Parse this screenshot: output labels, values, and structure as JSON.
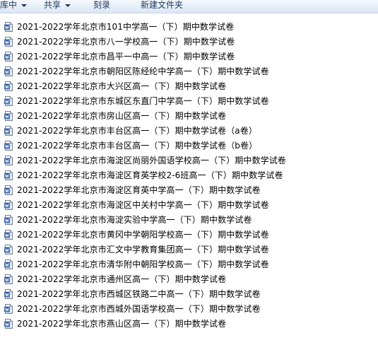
{
  "toolbar": {
    "items": [
      {
        "label": "库中"
      },
      {
        "label": "共享"
      },
      {
        "label": "刻录"
      },
      {
        "label": "新建文件夹"
      }
    ]
  },
  "files": [
    {
      "name": "2021-2022学年北京市101中学高一（下）期中数学试卷",
      "icon": "word-doc-icon"
    },
    {
      "name": "2021-2022学年北京市八一学校高一（下）期中数学试卷",
      "icon": "word-doc-icon"
    },
    {
      "name": "2021-2022学年北京市昌平一中高一（下）期中数学试卷",
      "icon": "word-doc-icon"
    },
    {
      "name": "2021-2022学年北京市朝阳区陈经纶中学高一（下）期中数学试卷",
      "icon": "word-doc-icon"
    },
    {
      "name": "2021-2022学年北京市大兴区高一（下）期中数学试卷",
      "icon": "word-doc-icon"
    },
    {
      "name": "2021-2022学年北京市东城区东直门中学高一（下）期中数学试卷",
      "icon": "word-doc-icon"
    },
    {
      "name": "2021-2022学年北京市房山区高一（下）期中数学试卷",
      "icon": "word-doc-icon"
    },
    {
      "name": "2021-2022学年北京市丰台区高一（下）期中数学试卷（a卷）",
      "icon": "word-doc-icon"
    },
    {
      "name": "2021-2022学年北京市丰台区高一（下）期中数学试卷（b卷）",
      "icon": "word-doc-icon"
    },
    {
      "name": "2021-2022学年北京市海淀区尚丽外国语学校高一（下）期中数学试卷",
      "icon": "word-doc-icon"
    },
    {
      "name": "2021-2022学年北京市海淀区育英学校2-6班高一（下）期中数学试卷",
      "icon": "word-doc-icon"
    },
    {
      "name": "2021-2022学年北京市海淀区育英中学高一（下）期中数学试卷",
      "icon": "word-doc-icon"
    },
    {
      "name": "2021-2022学年北京市海淀区中关村中学高一（下）期中数学试卷",
      "icon": "word-doc-icon"
    },
    {
      "name": "2021-2022学年北京市海淀实验中学高一（下）期中数学试卷",
      "icon": "word-doc-icon"
    },
    {
      "name": "2021-2022学年北京市黄冈中学朝阳学校高一（下）期中数学试卷",
      "icon": "word-doc-icon"
    },
    {
      "name": "2021-2022学年北京市汇文中学教育集团高一（下）期中数学试卷",
      "icon": "word-doc-icon"
    },
    {
      "name": "2021-2022学年北京市清华附中朝阳学校高一（下）期中数学试卷",
      "icon": "word-doc-icon"
    },
    {
      "name": "2021-2022学年北京市通州区高一（下）期中数学试卷",
      "icon": "word-doc-icon"
    },
    {
      "name": "2021-2022学年北京市西城区铁路二中高一（下）期中数学试卷",
      "icon": "word-doc-icon"
    },
    {
      "name": "2021-2022学年北京市西城外国语学校高一（下）期中数学试卷",
      "icon": "word-doc-icon"
    },
    {
      "name": "2021-2022学年北京市燕山区高一（下）期中数学试卷",
      "icon": "word-doc-icon"
    }
  ]
}
